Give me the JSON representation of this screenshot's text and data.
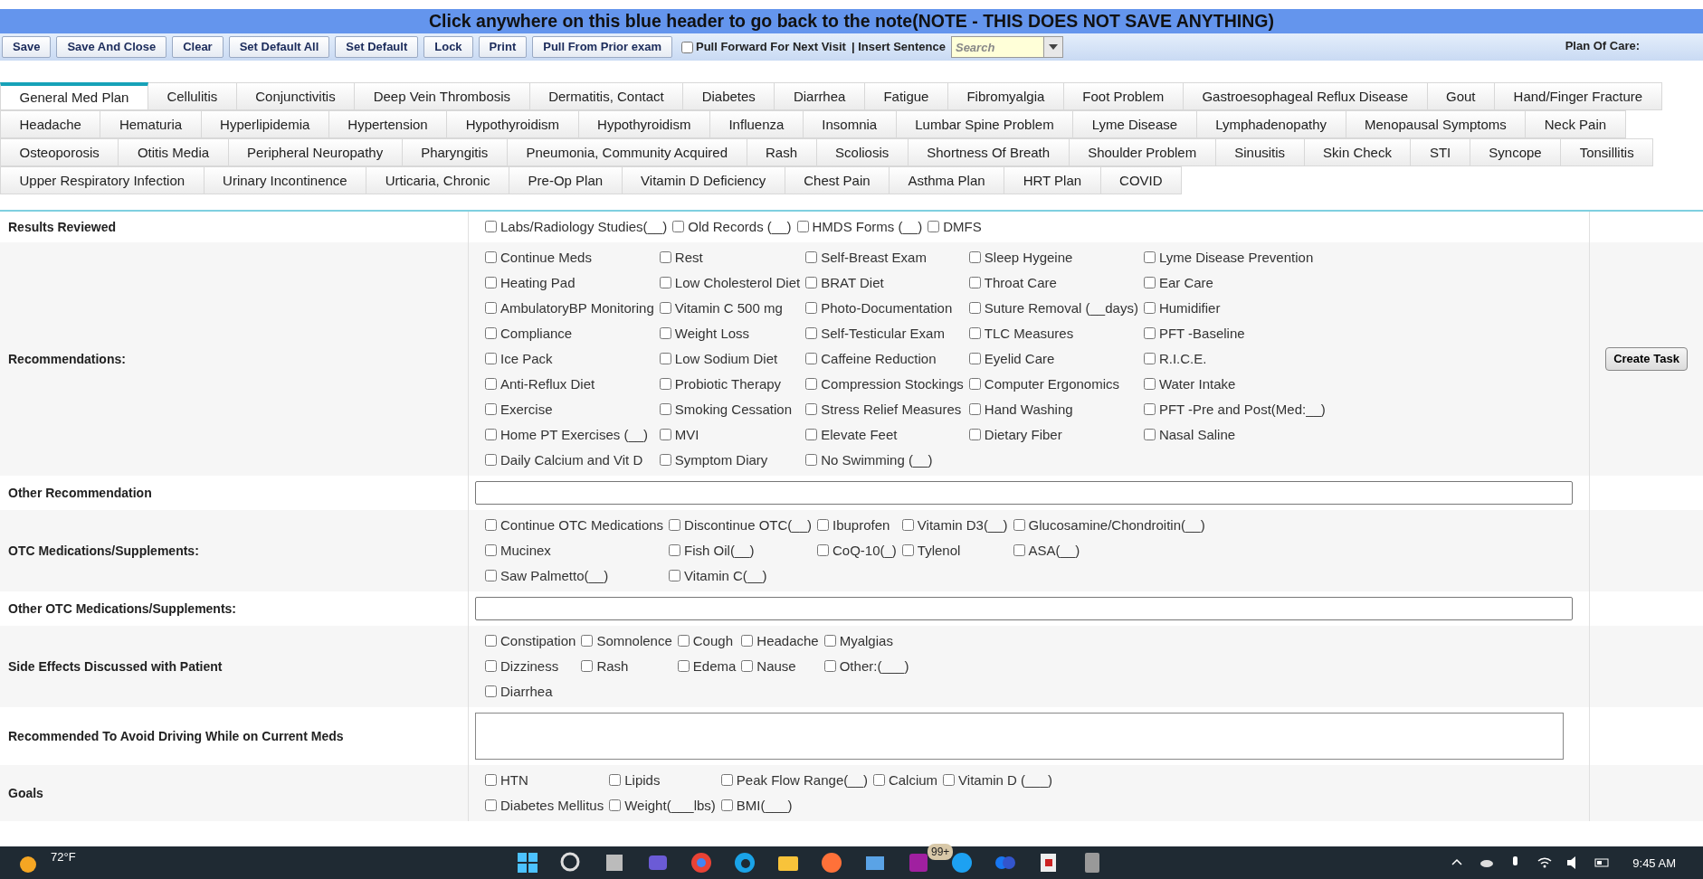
{
  "header": {
    "text": "Click anywhere on this blue header to go back to the note(NOTE - THIS DOES NOT SAVE ANYTHING)"
  },
  "toolbar": {
    "buttons": [
      "Save",
      "Save And Close",
      "Clear",
      "Set Default All",
      "Set Default",
      "Lock",
      "Print",
      "Pull From Prior exam"
    ],
    "pull_forward": {
      "label": "Pull Forward For Next Visit",
      "checked": false
    },
    "insert_sentence": "| Insert Sentence",
    "search": {
      "placeholder": "Search"
    },
    "plan_of_care": "Plan Of Care:"
  },
  "tab_rows": [
    [
      {
        "label": "General Med Plan",
        "selected": true
      },
      {
        "label": "Cellulitis",
        "selected": false
      },
      {
        "label": "Conjunctivitis",
        "selected": false
      },
      {
        "label": "Deep Vein Thrombosis",
        "selected": false
      },
      {
        "label": "Dermatitis, Contact",
        "selected": false
      },
      {
        "label": "Diabetes",
        "selected": false
      },
      {
        "label": "Diarrhea",
        "selected": false
      },
      {
        "label": "Fatigue",
        "selected": false
      },
      {
        "label": "Fibromyalgia",
        "selected": false
      },
      {
        "label": "Foot Problem",
        "selected": false
      },
      {
        "label": "Gastroesophageal Reflux Disease",
        "selected": false
      },
      {
        "label": "Gout",
        "selected": false
      },
      {
        "label": "Hand/Finger Fracture",
        "selected": false
      }
    ],
    [
      {
        "label": "Headache",
        "selected": false
      },
      {
        "label": "Hematuria",
        "selected": false
      },
      {
        "label": "Hyperlipidemia",
        "selected": false
      },
      {
        "label": "Hypertension",
        "selected": false
      },
      {
        "label": "Hypothyroidism",
        "selected": false
      },
      {
        "label": "Hypothyroidism",
        "selected": false
      },
      {
        "label": "Influenza",
        "selected": false
      },
      {
        "label": "Insomnia",
        "selected": false
      },
      {
        "label": "Lumbar Spine Problem",
        "selected": false
      },
      {
        "label": "Lyme Disease",
        "selected": false
      },
      {
        "label": "Lymphadenopathy",
        "selected": false
      },
      {
        "label": "Menopausal Symptoms",
        "selected": false
      },
      {
        "label": "Neck Pain",
        "selected": false
      }
    ],
    [
      {
        "label": "Osteoporosis",
        "selected": false
      },
      {
        "label": "Otitis Media",
        "selected": false
      },
      {
        "label": "Peripheral Neuropathy",
        "selected": false
      },
      {
        "label": "Pharyngitis",
        "selected": false
      },
      {
        "label": "Pneumonia, Community Acquired",
        "selected": false
      },
      {
        "label": "Rash",
        "selected": false
      },
      {
        "label": "Scoliosis",
        "selected": false
      },
      {
        "label": "Shortness Of Breath",
        "selected": false
      },
      {
        "label": "Shoulder Problem",
        "selected": false
      },
      {
        "label": "Sinusitis",
        "selected": false
      },
      {
        "label": "Skin Check",
        "selected": false
      },
      {
        "label": "STI",
        "selected": false
      },
      {
        "label": "Syncope",
        "selected": false
      },
      {
        "label": "Tonsillitis",
        "selected": false
      }
    ],
    [
      {
        "label": "Upper Respiratory Infection",
        "selected": false
      },
      {
        "label": "Urinary Incontinence",
        "selected": false
      },
      {
        "label": "Urticaria, Chronic",
        "selected": false
      },
      {
        "label": "Pre-Op Plan",
        "selected": false
      },
      {
        "label": "Vitamin D Deficiency",
        "selected": false
      },
      {
        "label": "Chest Pain",
        "selected": false
      },
      {
        "label": "Asthma Plan",
        "selected": false
      },
      {
        "label": "HRT Plan",
        "selected": false
      },
      {
        "label": "COVID",
        "selected": false
      }
    ]
  ],
  "sections": [
    {
      "label": "Results Reviewed",
      "kind": "checks",
      "rows": [
        [
          {
            "label": "Labs/Radiology Studies(__)",
            "checked": false
          },
          {
            "label": "Old Records (__)",
            "checked": false
          },
          {
            "label": "HMDS Forms (__)",
            "checked": false
          },
          {
            "label": "DMFS",
            "checked": false
          }
        ]
      ]
    },
    {
      "label": "Recommendations:",
      "kind": "checks",
      "action": "Create Task",
      "rows": [
        [
          {
            "label": "Continue Meds",
            "checked": false
          },
          {
            "label": "Rest",
            "checked": false
          },
          {
            "label": "Self-Breast Exam",
            "checked": false
          },
          {
            "label": "Sleep Hygeine",
            "checked": false
          },
          {
            "label": "Lyme Disease Prevention",
            "checked": false
          }
        ],
        [
          {
            "label": "Heating Pad",
            "checked": false
          },
          {
            "label": "Low Cholesterol Diet",
            "checked": false
          },
          {
            "label": "BRAT Diet",
            "checked": false
          },
          {
            "label": "Throat Care",
            "checked": false
          },
          {
            "label": "Ear Care",
            "checked": false
          }
        ],
        [
          {
            "label": "AmbulatoryBP Monitoring",
            "checked": false
          },
          {
            "label": "Vitamin C 500 mg",
            "checked": false
          },
          {
            "label": "Photo-Documentation",
            "checked": false
          },
          {
            "label": "Suture Removal (__days)",
            "checked": false
          },
          {
            "label": "Humidifier",
            "checked": false
          }
        ],
        [
          {
            "label": "Compliance",
            "checked": false
          },
          {
            "label": "Weight Loss",
            "checked": false
          },
          {
            "label": "Self-Testicular Exam",
            "checked": false
          },
          {
            "label": "TLC Measures",
            "checked": false
          },
          {
            "label": "PFT -Baseline",
            "checked": false
          }
        ],
        [
          {
            "label": "Ice Pack",
            "checked": false
          },
          {
            "label": "Low Sodium Diet",
            "checked": false
          },
          {
            "label": "Caffeine Reduction",
            "checked": false
          },
          {
            "label": "Eyelid Care",
            "checked": false
          },
          {
            "label": "R.I.C.E.",
            "checked": false
          }
        ],
        [
          {
            "label": "Anti-Reflux Diet",
            "checked": false
          },
          {
            "label": "Probiotic Therapy",
            "checked": false
          },
          {
            "label": "Compression Stockings",
            "checked": false
          },
          {
            "label": "Computer Ergonomics",
            "checked": false
          },
          {
            "label": "Water Intake",
            "checked": false
          }
        ],
        [
          {
            "label": "Exercise",
            "checked": false
          },
          {
            "label": "Smoking Cessation",
            "checked": false
          },
          {
            "label": "Stress Relief Measures",
            "checked": false
          },
          {
            "label": "Hand Washing",
            "checked": false
          },
          {
            "label": "PFT -Pre and Post(Med:__)",
            "checked": false
          }
        ],
        [
          {
            "label": "Home PT Exercises (__)",
            "checked": false
          },
          {
            "label": "MVI",
            "checked": false
          },
          {
            "label": "Elevate Feet",
            "checked": false
          },
          {
            "label": "Dietary Fiber",
            "checked": false
          },
          {
            "label": "Nasal Saline",
            "checked": false
          }
        ],
        [
          {
            "label": "Daily Calcium and Vit D",
            "checked": false
          },
          {
            "label": "Symptom Diary",
            "checked": false
          },
          {
            "label": "No Swimming (__)",
            "checked": false
          }
        ]
      ]
    },
    {
      "label": "Other Recommendation",
      "kind": "input"
    },
    {
      "label": "OTC Medications/Supplements:",
      "kind": "checks",
      "rows": [
        [
          {
            "label": "Continue OTC Medications",
            "checked": false
          },
          {
            "label": "Discontinue OTC(__)",
            "checked": false
          },
          {
            "label": "Ibuprofen",
            "checked": false
          },
          {
            "label": "Vitamin D3(__)",
            "checked": false
          },
          {
            "label": "Glucosamine/Chondroitin(__)",
            "checked": false
          }
        ],
        [
          {
            "label": "Mucinex",
            "checked": false
          },
          {
            "label": "Fish Oil(__)",
            "checked": false
          },
          {
            "label": "CoQ-10(_)",
            "checked": false
          },
          {
            "label": "Tylenol",
            "checked": false
          },
          {
            "label": "ASA(__)",
            "checked": false
          }
        ],
        [
          {
            "label": "Saw Palmetto(__)",
            "checked": false
          },
          {
            "label": "Vitamin C(__)",
            "checked": false
          }
        ]
      ]
    },
    {
      "label": "Other OTC Medications/Supplements:",
      "kind": "input"
    },
    {
      "label": "Side Effects Discussed with Patient",
      "kind": "checks",
      "rows": [
        [
          {
            "label": "Constipation",
            "checked": false
          },
          {
            "label": "Somnolence",
            "checked": false
          },
          {
            "label": "Cough",
            "checked": false
          },
          {
            "label": "Headache",
            "checked": false
          },
          {
            "label": "Myalgias",
            "checked": false
          }
        ],
        [
          {
            "label": "Dizziness",
            "checked": false
          },
          {
            "label": "Rash",
            "checked": false
          },
          {
            "label": "Edema",
            "checked": false
          },
          {
            "label": "Nause",
            "checked": false
          },
          {
            "label": "Other:(___)",
            "checked": false
          }
        ],
        [
          {
            "label": "Diarrhea",
            "checked": false
          }
        ]
      ]
    },
    {
      "label": "Recommended To Avoid Driving While on Current Meds",
      "kind": "textarea"
    },
    {
      "label": "Goals",
      "kind": "checks",
      "rows": [
        [
          {
            "label": "HTN",
            "checked": false
          },
          {
            "label": "Lipids",
            "checked": false
          },
          {
            "label": "Peak Flow Range(__)",
            "checked": false
          },
          {
            "label": "Calcium",
            "checked": false
          },
          {
            "label": "Vitamin D (___)",
            "checked": false
          }
        ],
        [
          {
            "label": "Diabetes Mellitus",
            "checked": false
          },
          {
            "label": "Weight(___lbs)",
            "checked": false
          },
          {
            "label": "BMI(___)",
            "checked": false
          }
        ]
      ]
    }
  ],
  "taskbar": {
    "weather": "72°F",
    "badge": "99+",
    "time": "9:45 AM"
  }
}
